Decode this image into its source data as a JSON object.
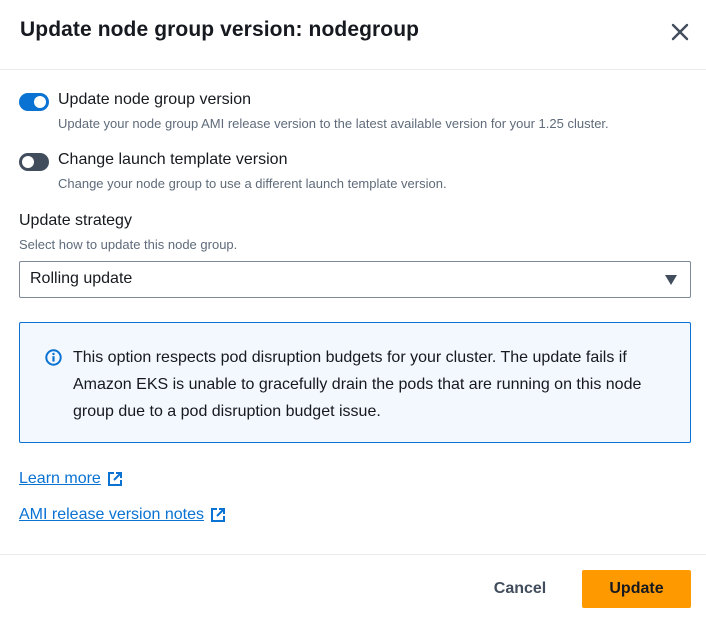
{
  "modal": {
    "title": "Update node group version: nodegroup"
  },
  "toggles": [
    {
      "label": "Update node group version",
      "description": "Update your node group AMI release version to the latest available version for your 1.25 cluster.",
      "checked": true
    },
    {
      "label": "Change launch template version",
      "description": "Change your node group to use a different launch template version.",
      "checked": false
    }
  ],
  "strategy": {
    "label": "Update strategy",
    "description": "Select how to update this node group.",
    "selected": "Rolling update"
  },
  "info": {
    "text": "This option respects pod disruption budgets for your cluster. The update fails if Amazon EKS is unable to gracefully drain the pods that are running on this node group due to a pod disruption budget issue."
  },
  "links": {
    "learn_more": "Learn more",
    "ami_notes": "AMI release version notes"
  },
  "footer": {
    "cancel_label": "Cancel",
    "update_label": "Update"
  },
  "colors": {
    "accent": "#0972d3",
    "primary_button": "#ff9900",
    "toggle_off": "#414d5c",
    "info_background": "#f2f8fd"
  }
}
